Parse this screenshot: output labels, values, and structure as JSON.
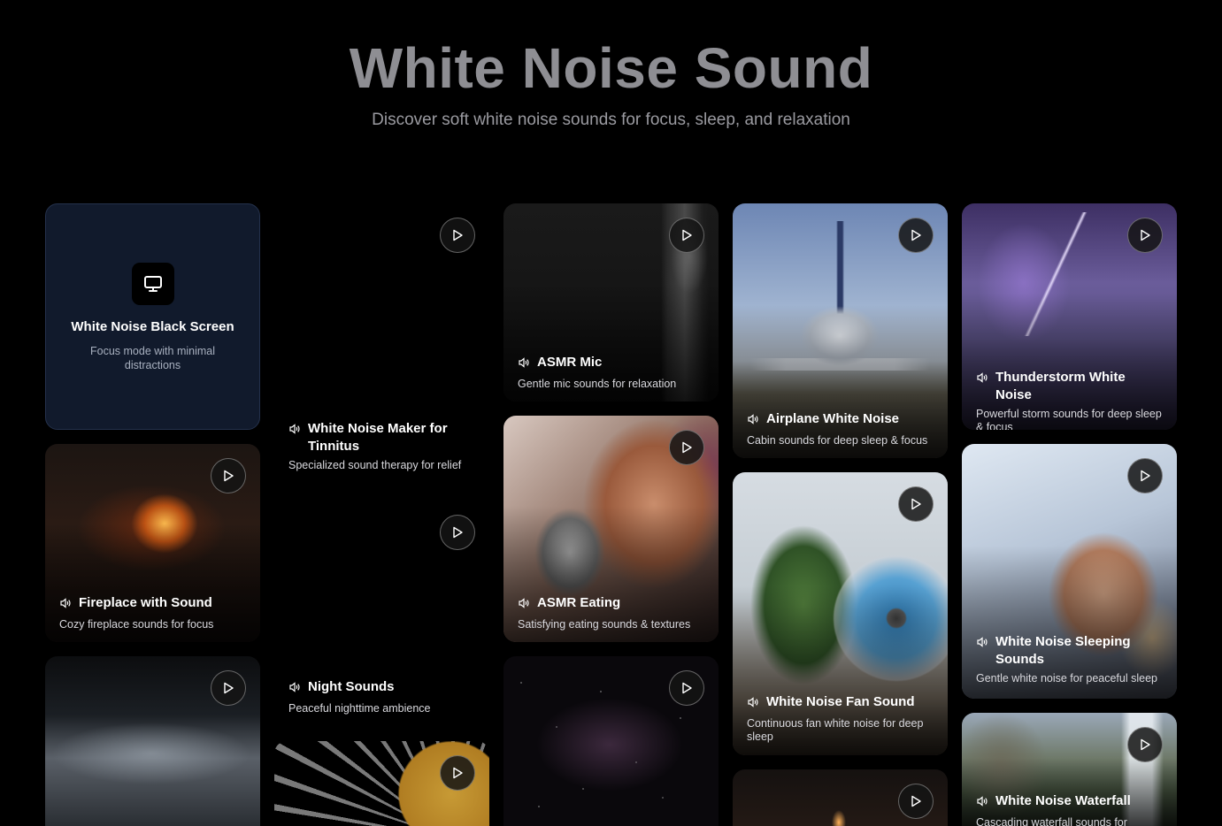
{
  "header": {
    "title": "White Noise Sound",
    "subtitle": "Discover soft white noise sounds for focus, sleep, and relaxation"
  },
  "colors": {
    "background": "#000000",
    "title": "#8e8e93",
    "black_screen_card": "#111a2c"
  },
  "cards": [
    {
      "title": "White Noise Black Screen",
      "description": "Focus mode with minimal distractions",
      "icon": "monitor-icon"
    },
    {
      "title": "White Noise Maker for Tinnitus",
      "description": "Specialized sound therapy for relief"
    },
    {
      "title": "ASMR Mic",
      "description": "Gentle mic sounds for relaxation"
    },
    {
      "title": "Airplane White Noise",
      "description": "Cabin sounds for deep sleep & focus"
    },
    {
      "title": "Thunderstorm White Noise",
      "description": "Powerful storm sounds for deep sleep & focus"
    },
    {
      "title": "Fireplace with Sound",
      "description": "Cozy fireplace sounds for focus"
    },
    {
      "title": "ASMR Eating",
      "description": "Satisfying eating sounds & textures"
    },
    {
      "title": "White Noise Fan Sound",
      "description": "Continuous fan white noise for deep sleep"
    },
    {
      "title": "White Noise Sleeping Sounds",
      "description": "Gentle white noise for peaceful sleep"
    },
    {
      "title": "Night Sounds",
      "description": "Peaceful nighttime ambience"
    },
    {
      "title": "White Noise Waterfall",
      "description": "Cascading waterfall sounds for"
    }
  ]
}
